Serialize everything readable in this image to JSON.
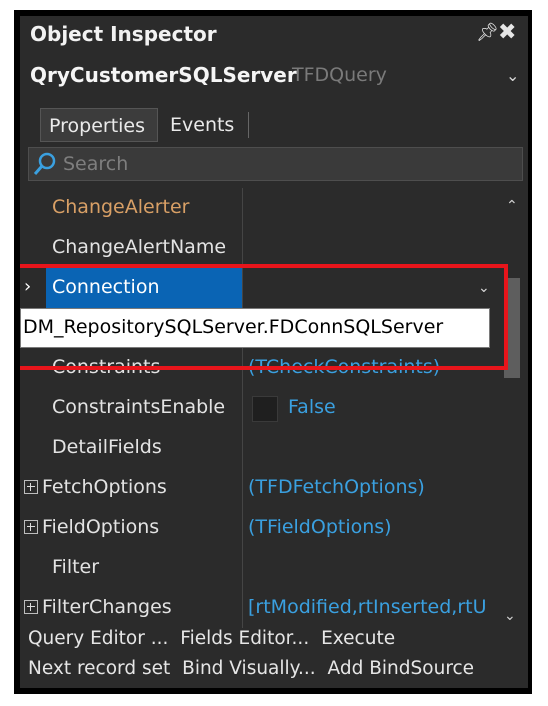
{
  "window": {
    "title": "Object Inspector",
    "pin_icon": "pin-icon",
    "close_icon": "close-icon"
  },
  "object_selector": {
    "name": "QryCustomerSQLServer",
    "type": "TFDQuery"
  },
  "tabs": [
    {
      "label": "Properties",
      "active": true
    },
    {
      "label": "Events",
      "active": false
    }
  ],
  "search": {
    "placeholder": "Search"
  },
  "properties": [
    {
      "name": "ChangeAlerter",
      "value": ""
    },
    {
      "name": "ChangeAlertName",
      "value": ""
    },
    {
      "name": "Connection",
      "value": "",
      "selected": true
    },
    {
      "name": "",
      "value": ""
    },
    {
      "name": "Constraints",
      "value": "(TCheckConstraints)"
    },
    {
      "name": "ConstraintsEnable",
      "value": "False"
    },
    {
      "name": "DetailFields",
      "value": ""
    },
    {
      "name": "FetchOptions",
      "value": "(TFDFetchOptions)",
      "expandable": true
    },
    {
      "name": "FieldOptions",
      "value": "(TFieldOptions)",
      "expandable": true
    },
    {
      "name": "Filter",
      "value": ""
    },
    {
      "name": "FilterChanges",
      "value": "[rtModified,rtInserted,rtU",
      "expandable": true
    }
  ],
  "connection_dropdown": {
    "value": "DM_RepositorySQLServer.FDConnSQLServer"
  },
  "actions": {
    "line1": [
      "Query Editor ...",
      "Fields Editor...",
      "Execute"
    ],
    "line2": [
      "Next record set",
      "Bind Visually...",
      "Add BindSource"
    ]
  },
  "colors": {
    "panel_bg": "#2b2b2b",
    "selection": "#0a64b4",
    "value_blue": "#3aa0e0",
    "highlight_red": "#e8151b",
    "orange_name": "#d9a066"
  }
}
